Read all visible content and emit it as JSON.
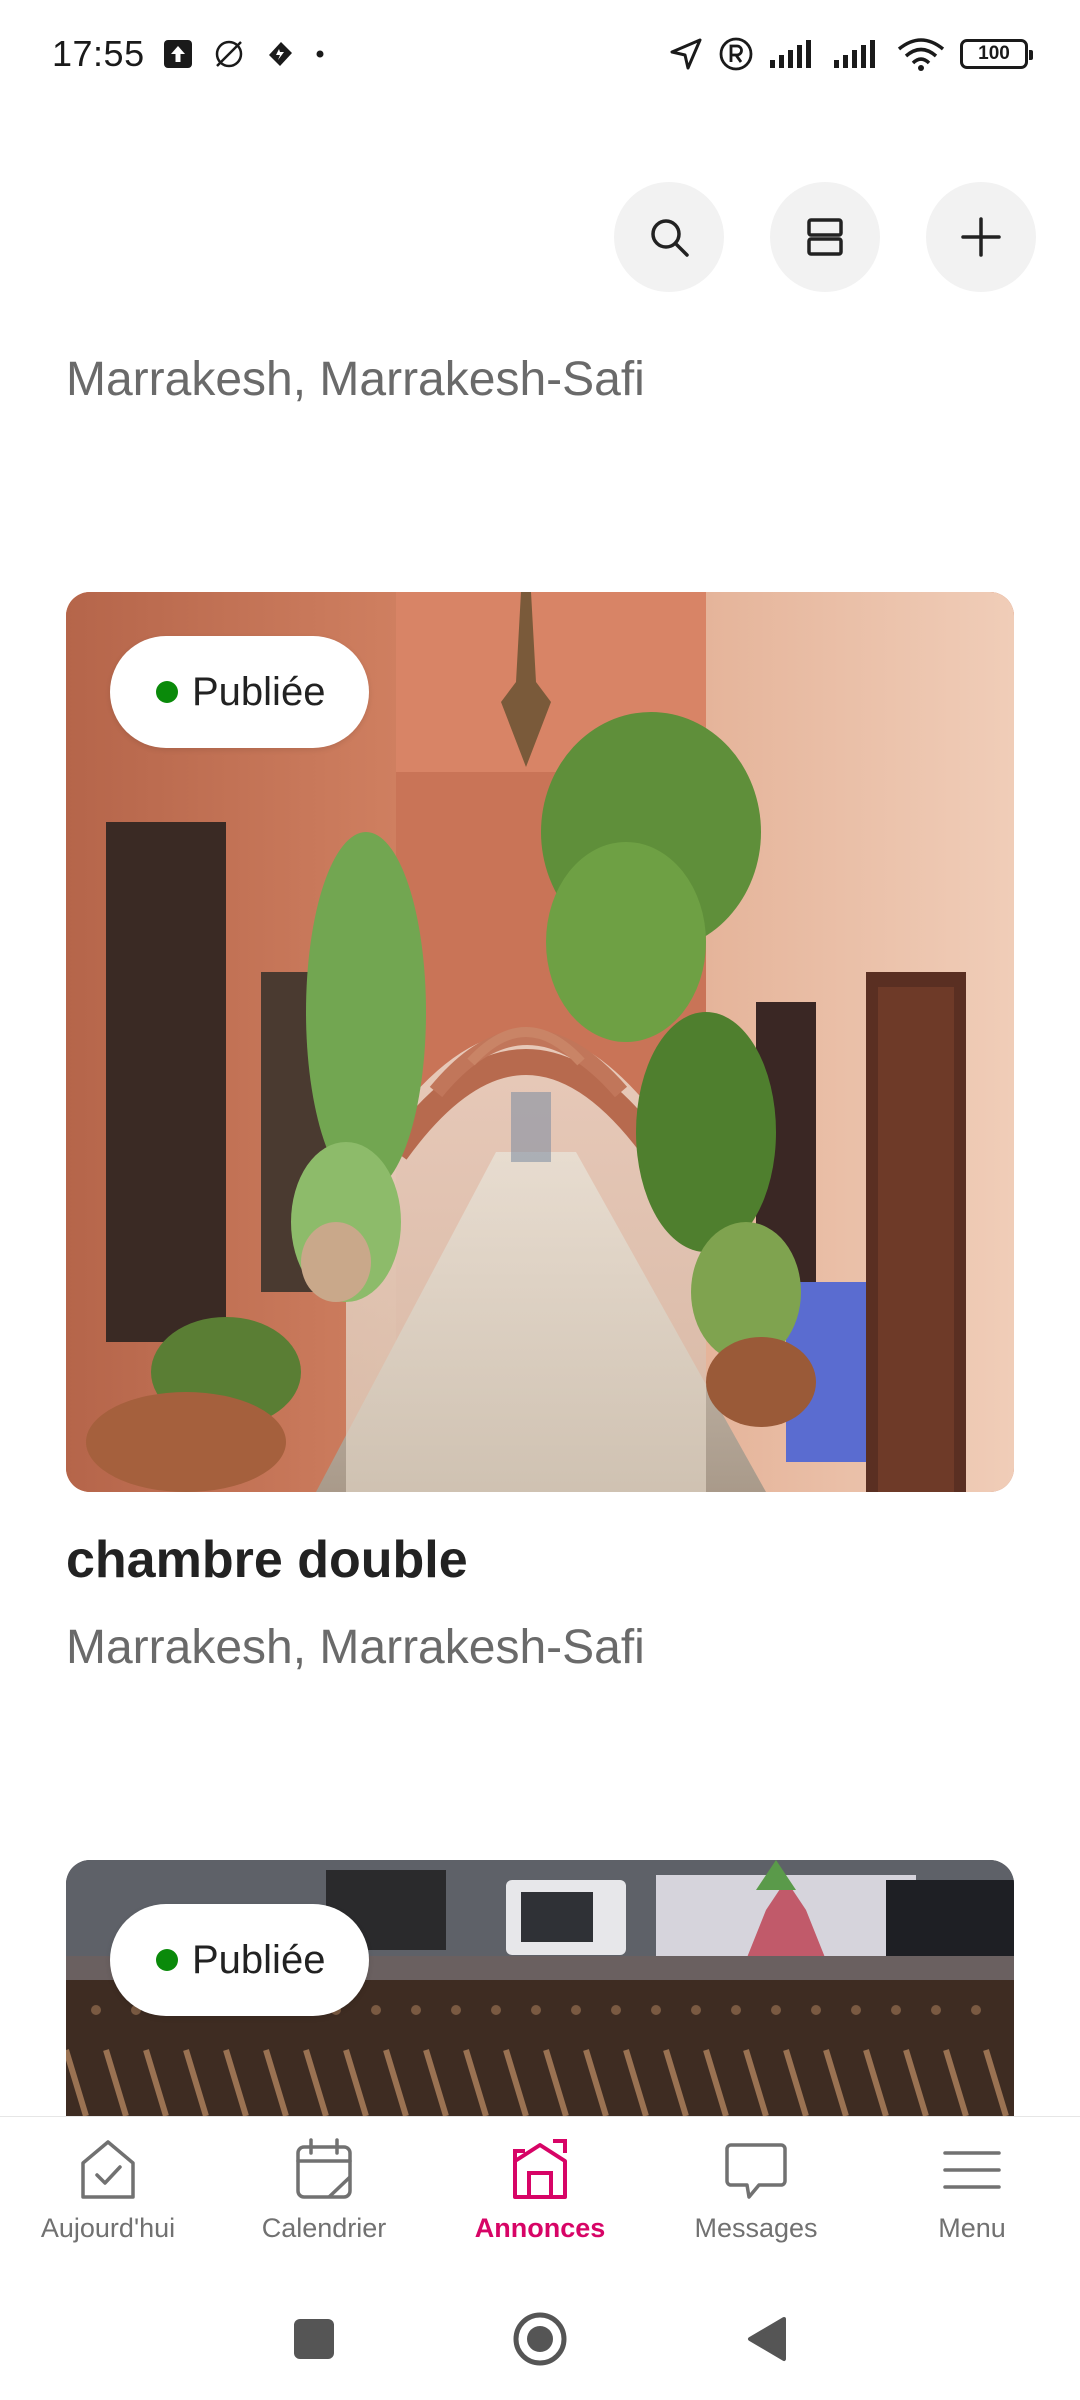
{
  "status_bar": {
    "time": "17:55",
    "battery": "100"
  },
  "listings": [
    {
      "title": "",
      "location": "Marrakesh, Marrakesh-Safi"
    },
    {
      "status": "Publiée",
      "title": "chambre double",
      "location": "Marrakesh, Marrakesh-Safi"
    },
    {
      "status": "Publiée"
    }
  ],
  "bottom_nav": {
    "items": [
      {
        "label": "Aujourd'hui",
        "icon": "today-check-icon"
      },
      {
        "label": "Calendrier",
        "icon": "calendar-icon"
      },
      {
        "label": "Annonces",
        "icon": "listings-house-icon",
        "active": true
      },
      {
        "label": "Messages",
        "icon": "chat-bubble-icon"
      },
      {
        "label": "Menu",
        "icon": "menu-icon"
      }
    ]
  },
  "colors": {
    "accent": "#d70466",
    "published_dot": "#0a8a0a",
    "text_secondary": "#6a6a6a"
  }
}
